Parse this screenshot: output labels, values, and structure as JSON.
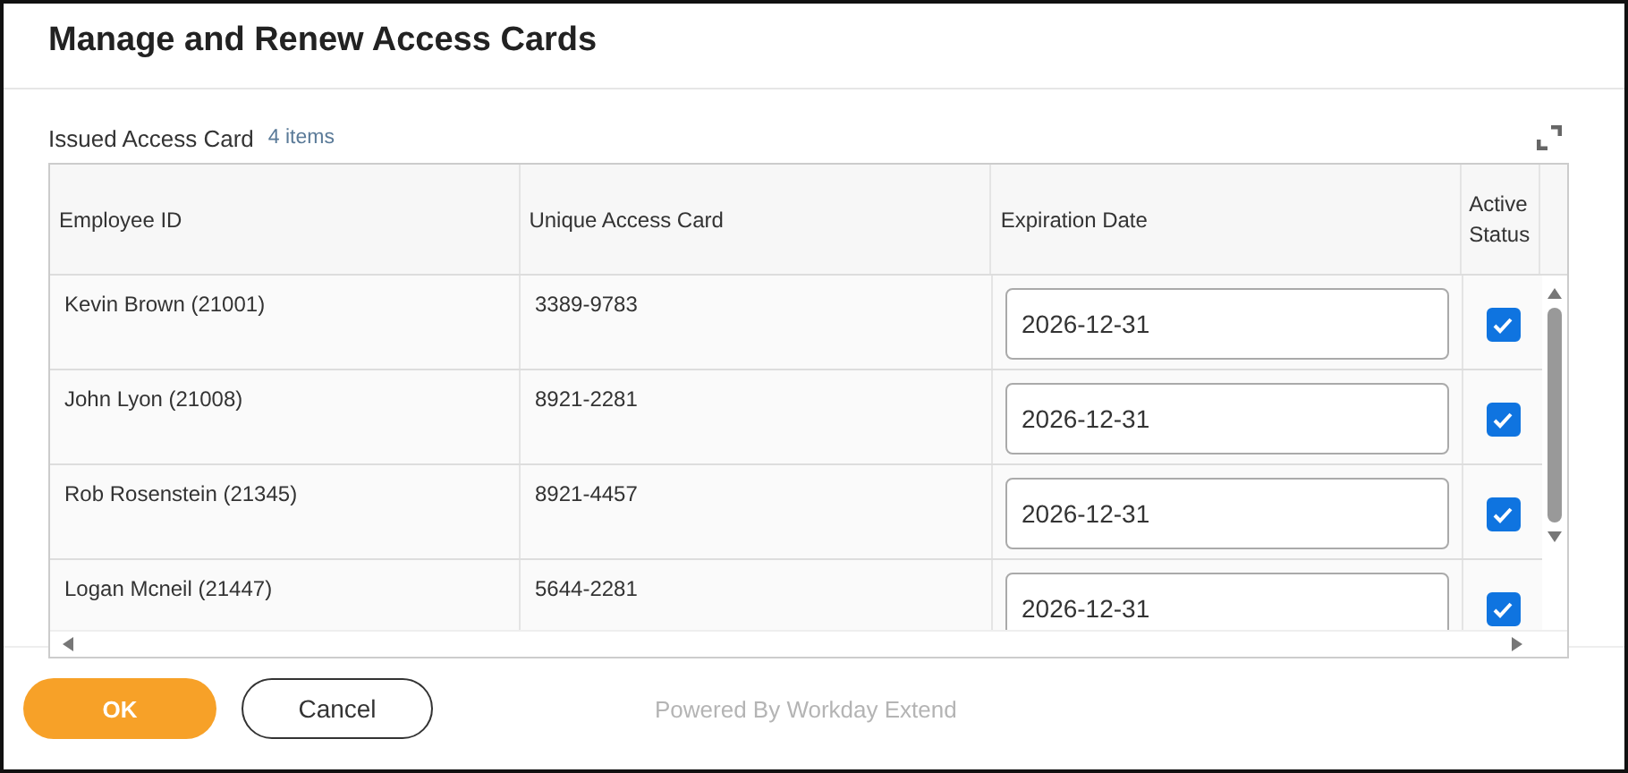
{
  "dialog": {
    "title": "Manage and Renew Access Cards"
  },
  "section": {
    "title": "Issued Access Card",
    "count": "4 items"
  },
  "table": {
    "columns": [
      "Employee ID",
      "Unique Access Card",
      "Expiration Date",
      "Active Status"
    ],
    "rows": [
      {
        "employee": "Kevin Brown (21001)",
        "card": "3389-9783",
        "expiration": "2026-12-31",
        "active": true
      },
      {
        "employee": "John Lyon (21008)",
        "card": "8921-2281",
        "expiration": "2026-12-31",
        "active": true
      },
      {
        "employee": "Rob Rosenstein (21345)",
        "card": "8921-4457",
        "expiration": "2026-12-31",
        "active": true
      },
      {
        "employee": "Logan Mcneil (21447)",
        "card": "5644-2281",
        "expiration": "2026-12-31",
        "active": true
      }
    ]
  },
  "buttons": [
    {
      "label": "OK",
      "kind": "primary"
    },
    {
      "label": "Cancel",
      "kind": "secondary"
    }
  ],
  "footer_note": "Powered By Workday Extend"
}
